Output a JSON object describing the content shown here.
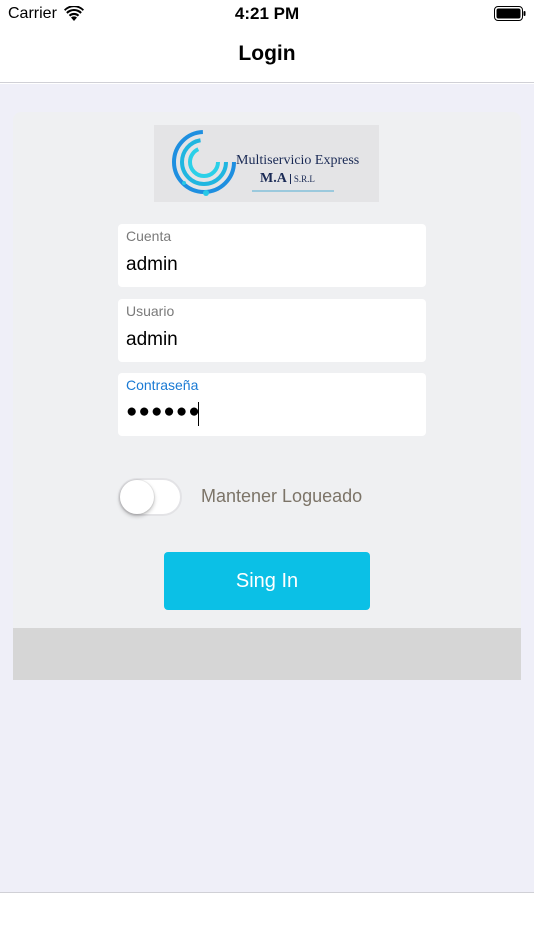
{
  "status_bar": {
    "carrier": "Carrier",
    "time": "4:21 PM",
    "wifi_icon": "wifi-icon",
    "battery_icon": "battery-icon"
  },
  "nav": {
    "title": "Login"
  },
  "logo": {
    "line1": "Multiservicio Express",
    "line2": "M.A",
    "srl": "S.R.L"
  },
  "form": {
    "cuenta": {
      "label": "Cuenta",
      "value": "admin"
    },
    "usuario": {
      "label": "Usuario",
      "value": "admin"
    },
    "password": {
      "label": "Contraseña",
      "masked_value": "●●●●●●"
    }
  },
  "remember": {
    "label": "Mantener Logueado",
    "checked": false
  },
  "signin_button": {
    "label": "Sing In"
  },
  "colors": {
    "accent": "#0bc0e6",
    "active_label": "#1a7ad4",
    "background": "#efeff8"
  }
}
